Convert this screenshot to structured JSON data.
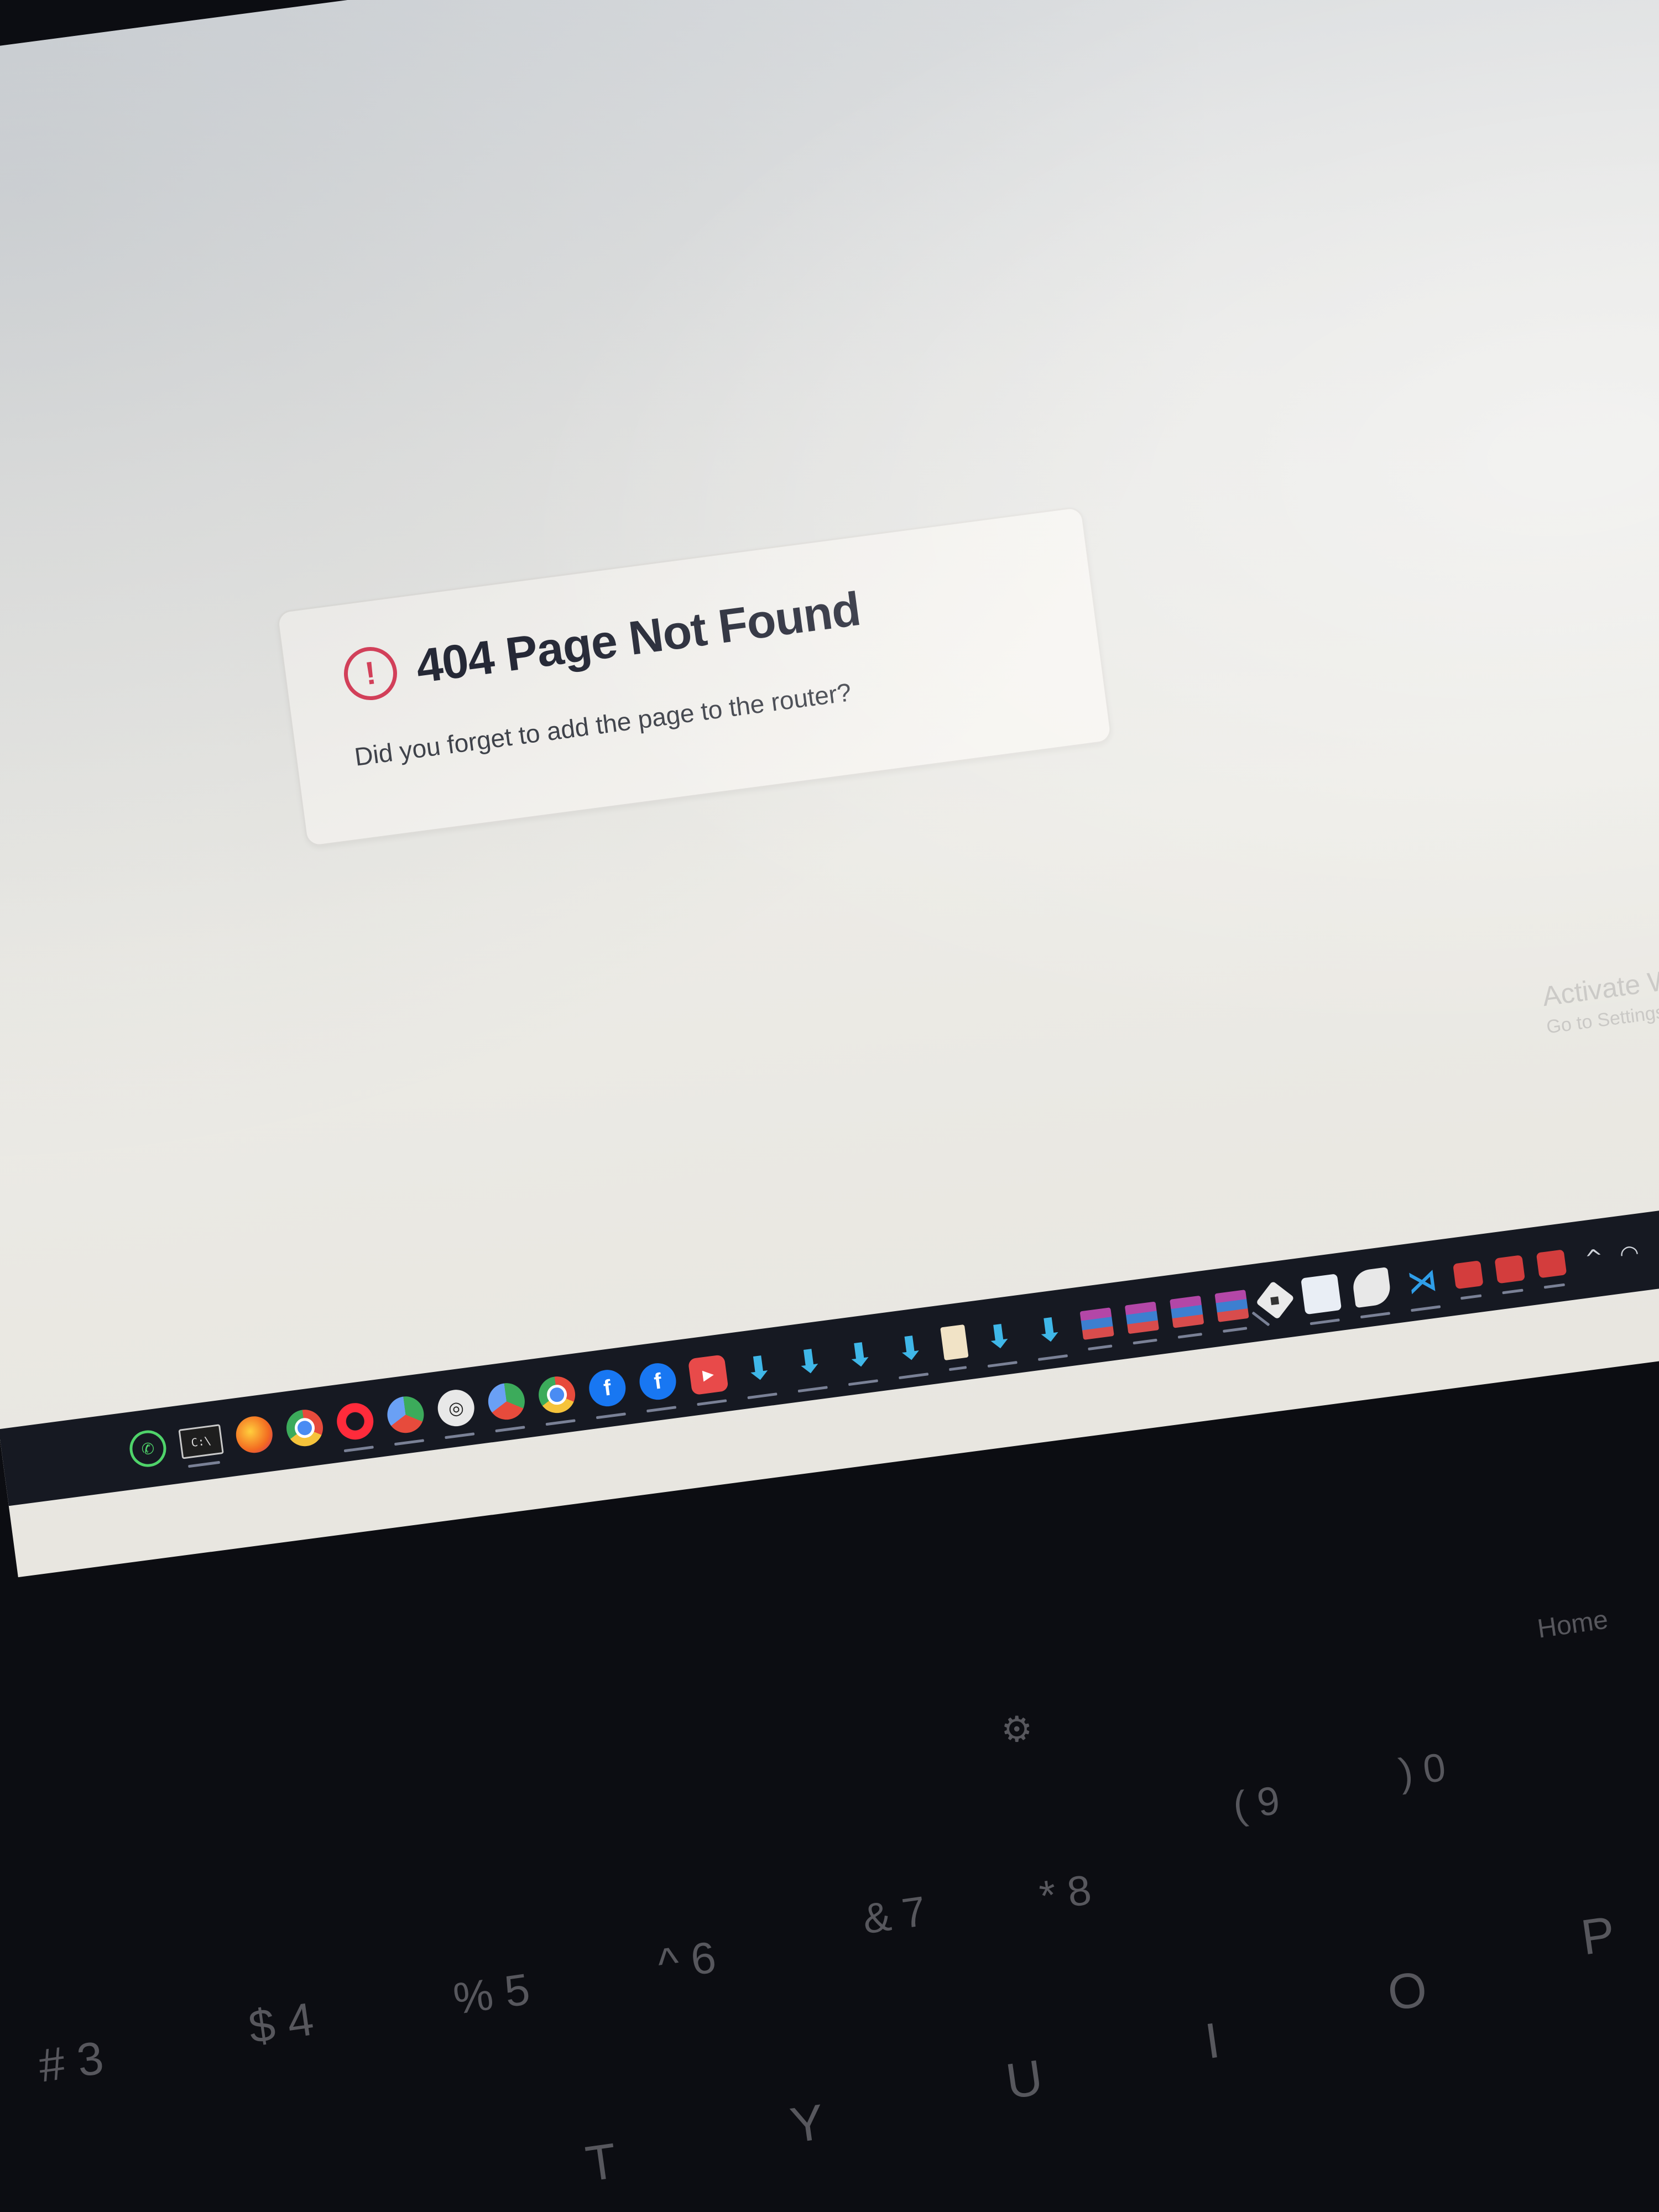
{
  "error_card": {
    "icon": "alert-circle-icon",
    "icon_glyph": "!",
    "title": "404 Page Not Found",
    "message": "Did you forget to add the page to the router?",
    "accent_color": "#d93a55"
  },
  "watermark": {
    "line1": "Activate W",
    "line2": "Go to Settings"
  },
  "taskbar": {
    "items": [
      {
        "name": "whatsapp-icon",
        "glyph": "✆"
      },
      {
        "name": "command-prompt-icon",
        "glyph": "C:\\"
      },
      {
        "name": "firefox-icon",
        "glyph": ""
      },
      {
        "name": "chrome-icon",
        "glyph": ""
      },
      {
        "name": "opera-icon",
        "glyph": ""
      },
      {
        "name": "chrome-profile-icon",
        "glyph": ""
      },
      {
        "name": "app-icon",
        "glyph": "◎"
      },
      {
        "name": "chrome-profile-2-icon",
        "glyph": ""
      },
      {
        "name": "chrome-active-icon",
        "glyph": ""
      },
      {
        "name": "facebook-icon",
        "glyph": "f"
      },
      {
        "name": "facebook-2-icon",
        "glyph": "f"
      },
      {
        "name": "youtube-icon",
        "glyph": "▶"
      },
      {
        "name": "download-icon",
        "glyph": "⬇"
      },
      {
        "name": "download-2-icon",
        "glyph": "⬇"
      },
      {
        "name": "download-3-icon",
        "glyph": "⬇"
      },
      {
        "name": "download-4-icon",
        "glyph": "⬇"
      },
      {
        "name": "notepad-icon",
        "glyph": ""
      },
      {
        "name": "download-5-icon",
        "glyph": "⬇"
      },
      {
        "name": "download-6-icon",
        "glyph": "⬇"
      },
      {
        "name": "winrar-icon",
        "glyph": ""
      },
      {
        "name": "winrar-2-icon",
        "glyph": ""
      },
      {
        "name": "winrar-3-icon",
        "glyph": ""
      },
      {
        "name": "winrar-4-icon",
        "glyph": ""
      },
      {
        "name": "git-icon",
        "glyph": "◆"
      },
      {
        "name": "box-app-icon",
        "glyph": ""
      },
      {
        "name": "eraser-icon",
        "glyph": ""
      },
      {
        "name": "vscode-icon",
        "glyph": "⋊"
      },
      {
        "name": "red-app-icon",
        "glyph": ""
      },
      {
        "name": "red-app-2-icon",
        "glyph": ""
      },
      {
        "name": "red-app-3-icon",
        "glyph": ""
      }
    ],
    "tray": {
      "chevron": "^",
      "wifi": "wifi-icon"
    }
  },
  "keyboard": {
    "keys": [
      {
        "label": "Home"
      },
      {
        "label": "⚙"
      },
      {
        "label": "( 9"
      },
      {
        "label": ") 0"
      },
      {
        "label": "* 8"
      },
      {
        "label": "& 7"
      },
      {
        "label": "^ 6"
      },
      {
        "label": "% 5"
      },
      {
        "label": "$ 4"
      },
      {
        "label": "# 3"
      },
      {
        "label": "T"
      },
      {
        "label": "Y"
      },
      {
        "label": "U"
      },
      {
        "label": "I"
      },
      {
        "label": "O"
      },
      {
        "label": "P"
      }
    ]
  }
}
